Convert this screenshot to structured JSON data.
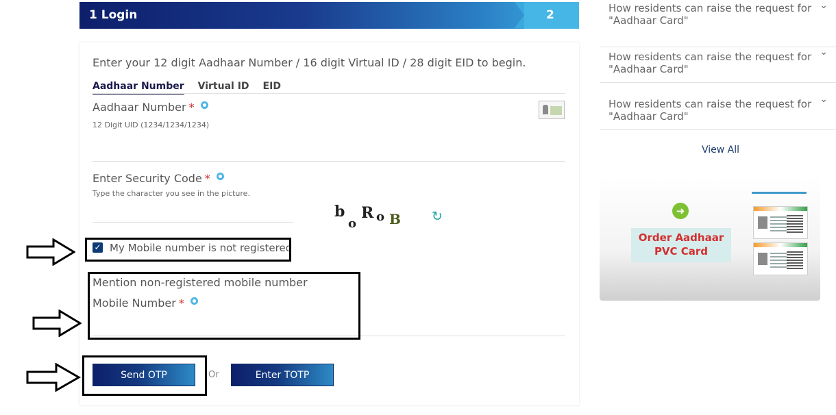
{
  "step": {
    "title": "1 Login",
    "next_number": "2"
  },
  "form": {
    "intro": "Enter your 12 digit Aadhaar Number / 16 digit Virtual ID / 28 digit EID to begin.",
    "tabs": [
      "Aadhaar Number",
      "Virtual ID",
      "EID"
    ],
    "active_tab": "Aadhaar Number",
    "aadhaar_label": "Aadhaar Number",
    "aadhaar_hint": "12 Digit UID (1234/1234/1234)",
    "security_label": "Enter Security Code",
    "security_hint": "Type the character you see in the picture.",
    "captcha_chars": [
      "b",
      "o",
      "R",
      "o",
      "B"
    ],
    "required_mark": "*",
    "mobile_not_registered_label": "My Mobile number is not registered",
    "mobile_not_registered_checked": true,
    "mention_label": "Mention non-registered mobile number",
    "mobile_label": "Mobile Number",
    "send_otp_label": "Send OTP",
    "or_label": "Or",
    "totp_label": "Enter TOTP"
  },
  "faq": {
    "items": [
      "How residents can raise the request for \"Aadhaar Card\"",
      "How residents can raise the request for \"Aadhaar Card\"",
      "How residents can raise the request for \"Aadhaar Card\""
    ],
    "view_all": "View All"
  },
  "banner": {
    "title": "Order Aadhaar PVC Card"
  },
  "icons": {
    "info": "info-icon",
    "refresh": "refresh-icon",
    "chevron": "chevron-down-icon",
    "id_card": "id-card-icon",
    "annotation_arrow": "arrow-right-icon"
  },
  "colors": {
    "header_dark": "#0d1f6b",
    "header_light": "#3fb0e4",
    "required": "#d32f2f",
    "checkbox": "#0d3a75",
    "banner_title": "#d32f2f"
  }
}
